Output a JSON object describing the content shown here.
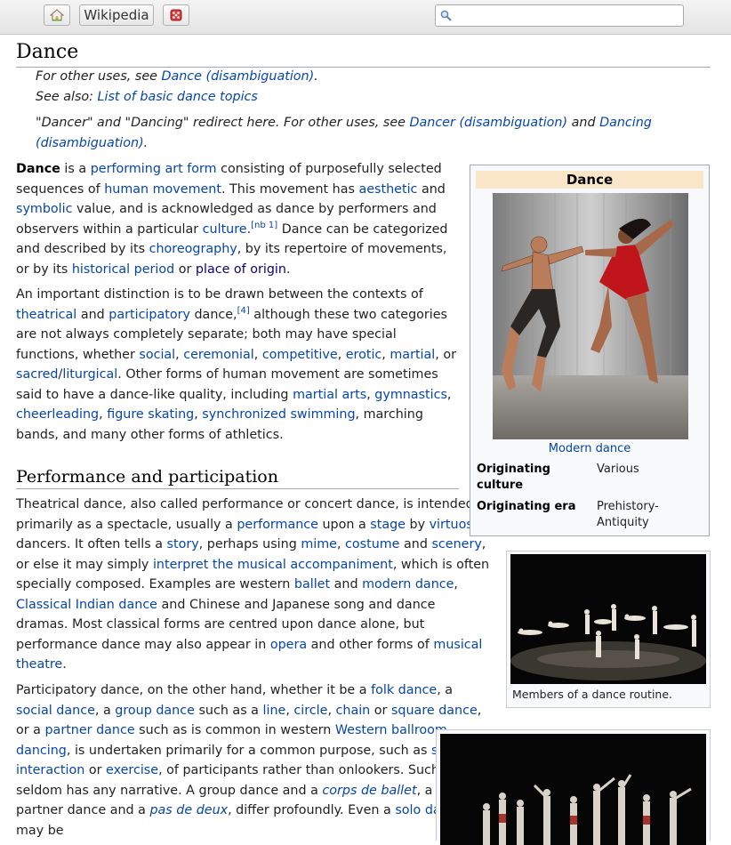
{
  "toolbar": {
    "home_icon": "home-icon",
    "wikipedia_label": "Wikipedia",
    "random_icon": "dice-icon",
    "search_placeholder": "",
    "search_value": ""
  },
  "article": {
    "title": "Dance",
    "hatnote1": {
      "prefix": "For other uses, see ",
      "link": "Dance (disambiguation)",
      "suffix": "."
    },
    "hatnote2": {
      "prefix": "See also: ",
      "link": "List of basic dance topics"
    },
    "hatnote3": {
      "t1": "\"Dancer\" and \"Dancing\" redirect here. For other uses, see ",
      "l1": "Dancer (disambiguation)",
      "t2": " and ",
      "l2": "Dancing (disambiguation)",
      "t3": "."
    },
    "intro1": {
      "b": "Dance",
      "t1": " is a ",
      "l1": "performing art form",
      "t2": " consisting of purposefully selected sequences of ",
      "l2": "human movement",
      "t3": ". This movement has ",
      "l3": "aesthetic",
      "t4": " and ",
      "l4": "symbolic",
      "t5": " value, and is acknowledged as dance by performers and observers within a particular ",
      "l5": "culture",
      "t6": ".",
      "sup": "[nb 1]",
      "t7": " Dance can be categorized and described by its ",
      "l6": "choreography",
      "t8": ", by its repertoire of movements, or by its ",
      "l7": "historical period",
      "t9": " or ",
      "l8": "place of origin",
      "t10": "."
    },
    "intro2": {
      "t1": "An important distinction is to be drawn between the contexts of ",
      "l1": "theatrical",
      "t2": " and ",
      "l2": "participatory",
      "t3": " dance,",
      "sup": "[4]",
      "t4": " although these two categories are not always completely separate; both may have special functions, whether ",
      "l3": "social",
      "t5": ", ",
      "l4": "ceremonial",
      "t6": ", ",
      "l5": "competitive",
      "t7": ", ",
      "l6": "erotic",
      "t8": ", ",
      "l7": "martial",
      "t9": ", or ",
      "l8": "sacred",
      "t10": "/",
      "l9": "liturgical",
      "t11": ". Other forms of human movement are sometimes said to have a dance-like quality, including ",
      "l10": "martial arts",
      "t12": ", ",
      "l11": "gymnastics",
      "t13": ", ",
      "l12": "cheerleading",
      "t14": ", ",
      "l13": "figure skating",
      "t15": ", ",
      "l14": "synchronized swimming",
      "t16": ", marching bands, and many other forms of athletics."
    },
    "section_heading": "Performance and participation",
    "perf1": {
      "t1": "Theatrical dance, also called performance or concert dance, is intended primarily as a spectacle, usually a ",
      "l1": "performance",
      "t2": " upon a ",
      "l2": "stage",
      "t3": " by ",
      "l3": "virtuoso",
      "t4": " dancers. It often tells a ",
      "l4": "story",
      "t5": ", perhaps using ",
      "l5": "mime",
      "t6": ", ",
      "l6": "costume",
      "t7": " and ",
      "l7": "scenery",
      "t8": ", or else it may simply ",
      "l8": "interpret the musical accompaniment",
      "t9": ", which is often specially composed. Examples are western ",
      "l9": "ballet",
      "t10": " and ",
      "l10": "modern dance",
      "t11": ", ",
      "l11": "Classical Indian dance",
      "t12": " and Chinese and Japanese song and dance dramas. Most classical forms are centred upon dance alone, but performance dance may also appear in ",
      "l12": "opera",
      "t13": " and other forms of ",
      "l13": "musical theatre",
      "t14": "."
    },
    "perf2": {
      "t1": "Participatory dance, on the other hand, whether it be a ",
      "l1": "folk dance",
      "t2": ", a ",
      "l2": "social dance",
      "t3": ", a ",
      "l3": "group dance",
      "t4": " such as a ",
      "l4": "line",
      "t5": ", ",
      "l5": "circle",
      "t6": ", ",
      "l6": "chain",
      "t7": " or ",
      "l7": "square dance",
      "t8": ", or a ",
      "l8": "partner dance",
      "t9": " such as is common in western ",
      "l9": "Western ballroom dancing",
      "t10": ", is undertaken primarily for a common purpose, such as ",
      "l10": "social interaction",
      "t11": " or ",
      "l11": "exercise",
      "t12": ", of participants rather than onlookers. Such dance seldom has any narrative. A group dance and a ",
      "l12": "corps de ballet",
      "t13": ", a social partner dance and a ",
      "l13": "pas de deux",
      "t14": ", differ profoundly. Even a ",
      "l14": "solo dance",
      "t15": " may be"
    }
  },
  "infobox": {
    "title": "Dance",
    "caption": "Modern dance",
    "rows": [
      {
        "label": "Originating culture",
        "value": "Various"
      },
      {
        "label": "Originating era",
        "value": "Prehistory-Antiquity"
      }
    ]
  },
  "thumb1": {
    "caption": "Members of a dance routine."
  },
  "colors": {
    "link": "#0645ad",
    "visited_link": "#0b0080",
    "infobox_header": "#f9e5c8",
    "border": "#a2a9b1"
  }
}
